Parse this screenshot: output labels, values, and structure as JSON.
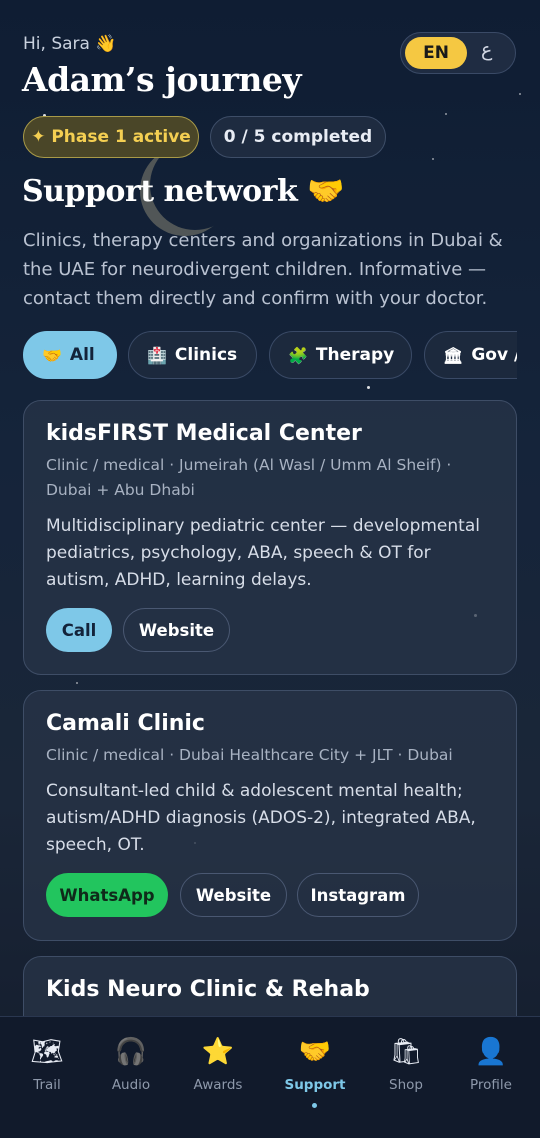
{
  "header": {
    "greeting": "Hi, Sara",
    "greeting_emoji": "👋",
    "title": "Adam’s journey"
  },
  "language": {
    "active": "EN",
    "alternate": "ع"
  },
  "status": {
    "phase_label": "✦ Phase 1 active",
    "progress_label": "0 / 5 completed"
  },
  "support": {
    "heading": "Support network",
    "heading_emoji": "🤝",
    "description": "Clinics, therapy centers and organizations in Dubai & the UAE for neurodivergent children. Informative — contact them directly and confirm with your doctor."
  },
  "filters": [
    {
      "icon": "🤝",
      "label": "All",
      "active": true
    },
    {
      "icon": "🏥",
      "label": "Clinics"
    },
    {
      "icon": "🧩",
      "label": "Therapy"
    },
    {
      "icon": "🏛",
      "label": "Gov /"
    }
  ],
  "cards": [
    {
      "name": "kidsFIRST Medical Center",
      "meta": "Clinic / medical · Jumeirah (Al Wasl / Umm Al Sheif) · Dubai + Abu Dhabi",
      "description": "Multidisciplinary pediatric center — developmental pediatrics, psychology, ABA, speech & OT for autism, ADHD, learning delays.",
      "actions": [
        "Call",
        "Website"
      ]
    },
    {
      "name": "Camali Clinic",
      "meta": "Clinic / medical · Dubai Healthcare City + JLT · Dubai",
      "description": "Consultant-led child & adolescent mental health; autism/ADHD diagnosis (ADOS-2), integrated ABA, speech, OT.",
      "actions": [
        "WhatsApp",
        "Website",
        "Instagram"
      ]
    },
    {
      "name": "Kids Neuro Clinic & Rehab",
      "meta": "",
      "description": "",
      "actions": []
    }
  ],
  "nav": [
    {
      "icon": "🗺",
      "label": "Trail"
    },
    {
      "icon": "🎧",
      "label": "Audio"
    },
    {
      "icon": "⭐",
      "label": "Awards"
    },
    {
      "icon": "🤝",
      "label": "Support",
      "active": true
    },
    {
      "icon": "🛍",
      "label": "Shop"
    },
    {
      "icon": "👤",
      "label": "Profile"
    }
  ],
  "colors": {
    "accent": "#7ec8e8",
    "gold": "#f5c842",
    "whatsapp": "#22c55e",
    "background": "#15243a"
  }
}
